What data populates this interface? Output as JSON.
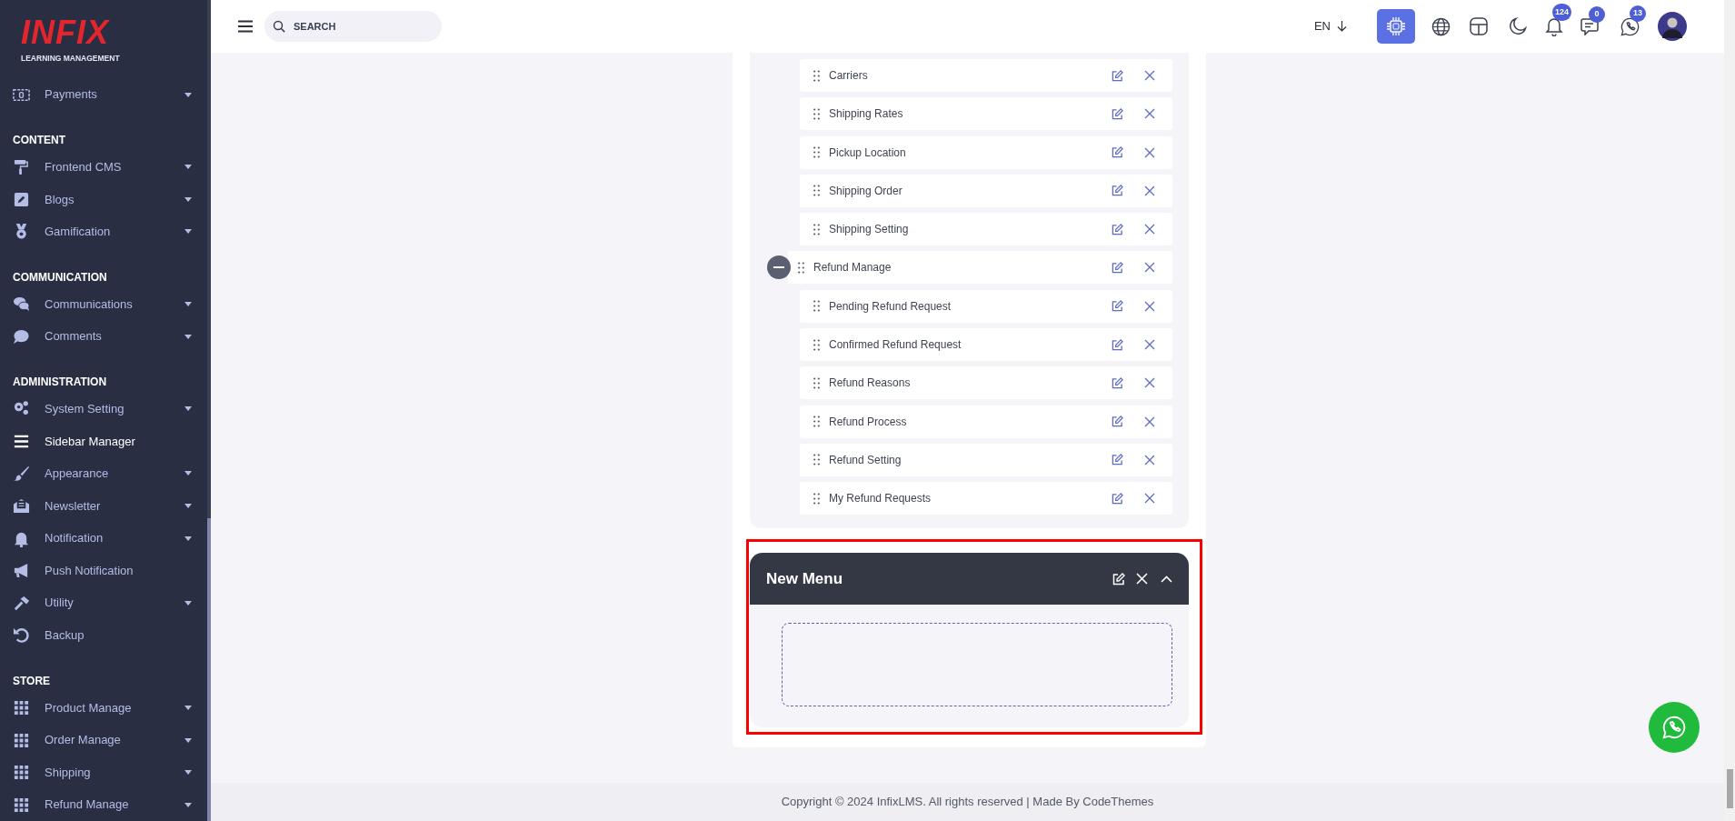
{
  "logo": {
    "wordmark": "INFIX",
    "tagline": "LEARNING MANAGEMENT"
  },
  "sidebar": {
    "sections": [
      {
        "items": [
          {
            "label": "Payments",
            "dropdown": true,
            "selected": false
          }
        ]
      },
      {
        "heading": "CONTENT",
        "items": [
          {
            "label": "Frontend CMS",
            "dropdown": true,
            "selected": false
          },
          {
            "label": "Blogs",
            "dropdown": true,
            "selected": false
          },
          {
            "label": "Gamification",
            "dropdown": true,
            "selected": false
          }
        ]
      },
      {
        "heading": "COMMUNICATION",
        "items": [
          {
            "label": "Communications",
            "dropdown": true,
            "selected": false
          },
          {
            "label": "Comments",
            "dropdown": true,
            "selected": false
          }
        ]
      },
      {
        "heading": "ADMINISTRATION",
        "items": [
          {
            "label": "System Setting",
            "dropdown": true,
            "selected": false
          },
          {
            "label": "Sidebar Manager",
            "dropdown": false,
            "selected": true
          },
          {
            "label": "Appearance",
            "dropdown": true,
            "selected": false
          },
          {
            "label": "Newsletter",
            "dropdown": true,
            "selected": false
          },
          {
            "label": "Notification",
            "dropdown": true,
            "selected": false
          },
          {
            "label": "Push Notification",
            "dropdown": false,
            "selected": false
          },
          {
            "label": "Utility",
            "dropdown": true,
            "selected": false
          },
          {
            "label": "Backup",
            "dropdown": false,
            "selected": false
          }
        ]
      },
      {
        "heading": "STORE",
        "items": [
          {
            "label": "Product Manage",
            "dropdown": true,
            "selected": false
          },
          {
            "label": "Order Manage",
            "dropdown": true,
            "selected": false
          },
          {
            "label": "Shipping",
            "dropdown": true,
            "selected": false
          },
          {
            "label": "Refund Manage",
            "dropdown": true,
            "selected": false
          }
        ]
      }
    ]
  },
  "topbar": {
    "search": {
      "placeholder": "SEARCH"
    },
    "language": "EN",
    "notifications": "124",
    "messages": "0",
    "whatsapp": "13"
  },
  "menu_tree": [
    {
      "children": [
        {
          "label": "Carriers"
        },
        {
          "label": "Shipping Rates"
        },
        {
          "label": "Pickup Location"
        },
        {
          "label": "Shipping Order"
        },
        {
          "label": "Shipping Setting"
        }
      ]
    },
    {
      "label": "Refund Manage",
      "expanded": true,
      "children": [
        {
          "label": "Pending Refund Request"
        },
        {
          "label": "Confirmed Refund Request"
        },
        {
          "label": "Refund Reasons"
        },
        {
          "label": "Refund Process"
        },
        {
          "label": "Refund Setting"
        },
        {
          "label": "My Refund Requests"
        }
      ]
    }
  ],
  "new_menu": {
    "title": "New Menu",
    "expanded": true
  },
  "footer": "Copyright © 2024 InfixLMS. All rights reserved | Made By CodeThemes"
}
